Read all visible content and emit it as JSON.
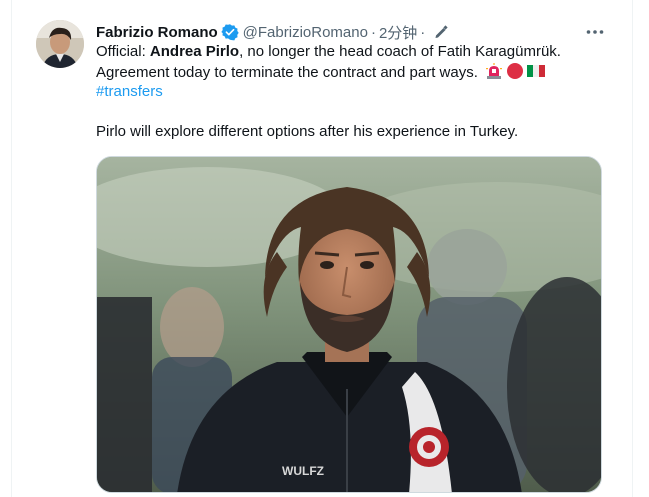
{
  "tweet": {
    "author_name": "Fabrizio Romano",
    "handle": "@FabrizioRomano",
    "separator": "·",
    "time": "2分钟",
    "text": {
      "prefix": "Official: ",
      "name": "Andrea Pirlo",
      "line1_rest": ", no longer the head coach of Fatih Karagümrük.",
      "line2": "Agreement today to terminate the contract and part ways.",
      "hashtag": "#transfers",
      "paragraph2": "Pirlo will explore different options after his experience in Turkey."
    },
    "emojis": [
      "siren-emoji",
      "red-circle-emoji",
      "italy-flag-emoji"
    ],
    "media": {
      "jacket_brand": "WULFZ"
    }
  },
  "colors": {
    "link": "#1d9bf0",
    "verified": "#1d9bf0",
    "secondary_text": "#536471",
    "primary_text": "#0f1419"
  },
  "icons": [
    "verified-badge-icon",
    "edit-icon",
    "more-icon"
  ]
}
